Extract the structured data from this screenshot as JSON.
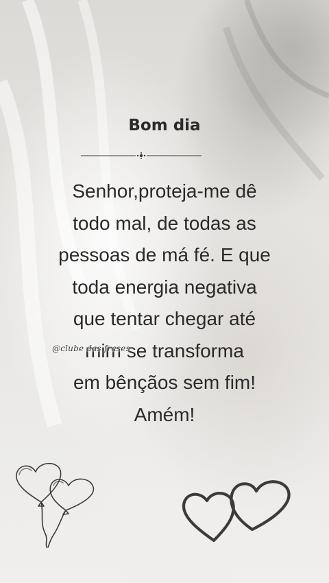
{
  "header": {
    "title": "Bom dia"
  },
  "message": {
    "lines": [
      "Senhor,proteja-me dê",
      "todo mal, de todas as",
      "pessoas de má fé. E que",
      "toda energia negativa",
      "que tentar chegar até",
      "mim se transforma",
      "em bênçãos sem fim!",
      "Amém!"
    ]
  },
  "watermark": {
    "text": "@clube das frases"
  },
  "icons": {
    "divider": "ornamental-divider-icon",
    "left": "heart-balloons-icon",
    "right": "two-hearts-icon"
  }
}
